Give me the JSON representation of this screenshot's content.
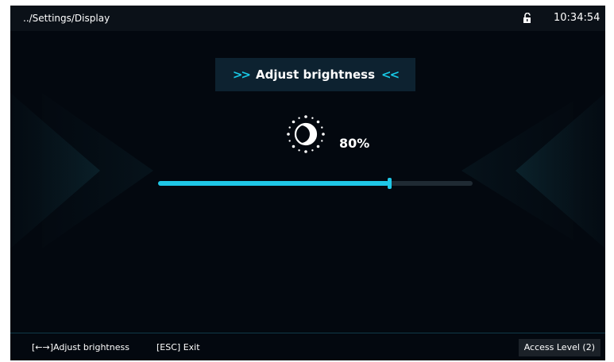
{
  "header": {
    "path": "../Settings/Display",
    "time": "10:34:54"
  },
  "dialog": {
    "title": "Adjust brightness",
    "left_arrows": ">>",
    "right_arrows": "<<"
  },
  "brightness": {
    "value": 0.8,
    "label": "80%"
  },
  "footer": {
    "adjust_hint": "[←→]Adjust brightness",
    "exit_hint": "[ESC] Exit",
    "access_level": "Access Level  (2)"
  },
  "colors": {
    "accent": "#1fc7e6",
    "background": "#03080f",
    "bar": "#0b1118"
  },
  "icons": {
    "lock": "unlocked-padlock-icon",
    "brightness": "brightness-sun-icon"
  }
}
